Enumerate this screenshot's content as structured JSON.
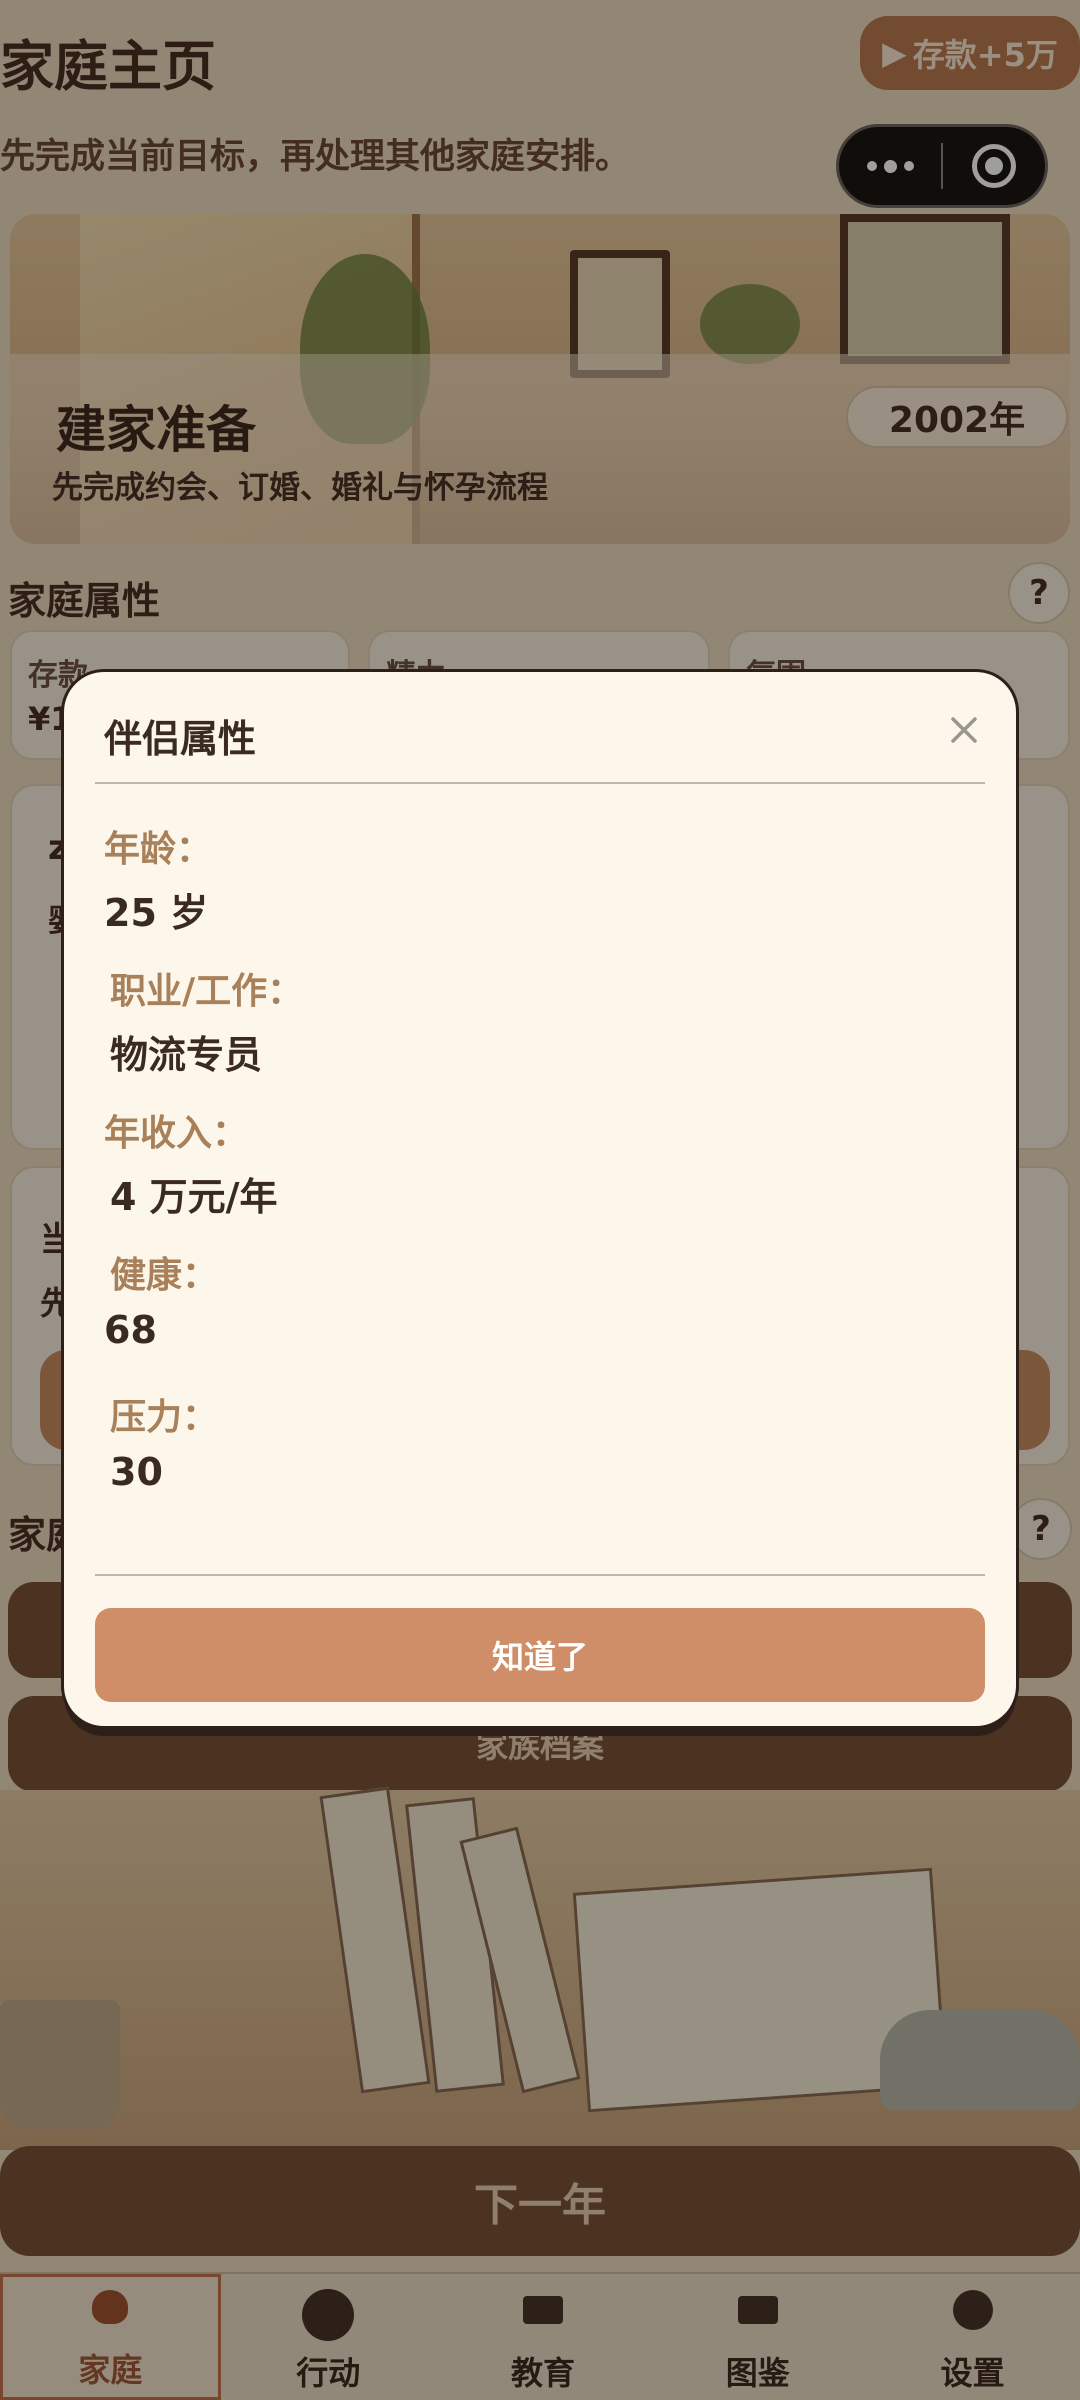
{
  "header": {
    "title": "家庭主页",
    "subtitle": "先完成当前目标，再处理其他家庭安排。",
    "savings_button": "存款+5万",
    "capsule_icons": [
      "more-dots-icon",
      "target-icon"
    ]
  },
  "banner": {
    "title": "建家准备",
    "subtitle": "先完成约会、订婚、婚礼与怀孕流程",
    "year": "2002年"
  },
  "attributes": {
    "title": "家庭属性",
    "help": "?",
    "cards": [
      {
        "label": "存款",
        "value": "¥1"
      },
      {
        "label": "精力",
        "value": ""
      },
      {
        "label": "氛围",
        "value": ""
      }
    ]
  },
  "goal_card": {
    "title_fragment": "z",
    "text_fragment": "婴"
  },
  "current_card": {
    "title_fragment": "当",
    "text_fragment": "先"
  },
  "family_section": {
    "title_fragment": "家庭",
    "help": "?"
  },
  "archive_button": "家族档案",
  "next_year_button": "下一年",
  "tabs": [
    {
      "label": "家庭",
      "icon": "home-poop-icon",
      "active": true
    },
    {
      "label": "行动",
      "icon": "action-icon",
      "active": false
    },
    {
      "label": "教育",
      "icon": "education-book-icon",
      "active": false
    },
    {
      "label": "图鉴",
      "icon": "codex-book-icon",
      "active": false
    },
    {
      "label": "设置",
      "icon": "settings-icon",
      "active": false
    }
  ],
  "modal": {
    "title": "伴侣属性",
    "close_icon": "close-icon",
    "fields": [
      {
        "label": "年龄：",
        "value": "25 岁"
      },
      {
        "label": "职业/工作：",
        "value": "物流专员"
      },
      {
        "label": "年收入：",
        "value": "4 万元/年"
      },
      {
        "label": "健康：",
        "value": "68"
      },
      {
        "label": "压力：",
        "value": "30"
      }
    ],
    "confirm_button": "知道了"
  },
  "colors": {
    "modal_bg": "#fcf7ea",
    "accent_button": "#d08e68",
    "label_color": "#a8805a",
    "text_dark": "#3b2a22"
  }
}
